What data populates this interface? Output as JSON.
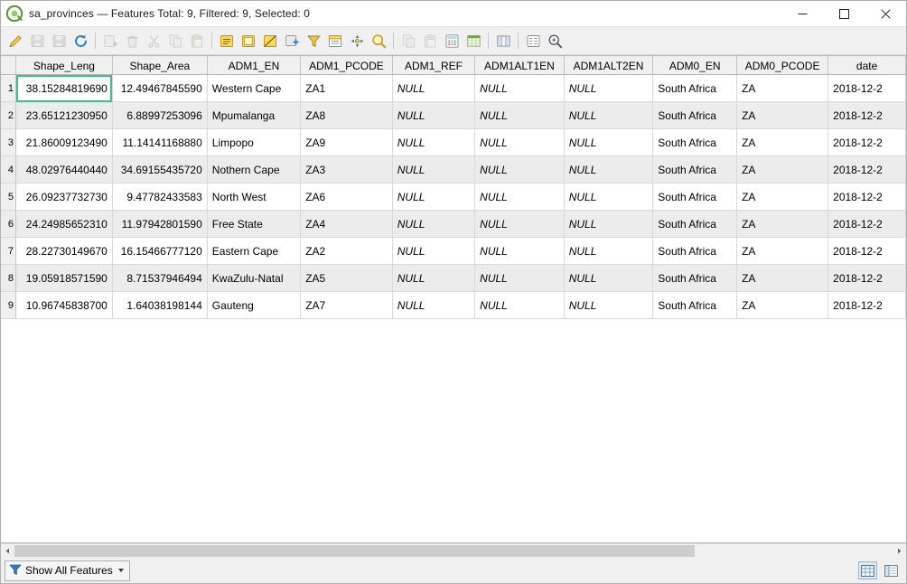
{
  "window": {
    "app_icon": "qgis-logo-icon",
    "title": "sa_provinces — Features Total: 9, Filtered: 9, Selected: 0",
    "controls": {
      "minimize": "minimize-icon",
      "maximize": "maximize-icon",
      "close": "close-icon"
    }
  },
  "toolbar": {
    "items": [
      {
        "name": "toggle-editing-button",
        "icon": "pencil-icon",
        "enabled": true
      },
      {
        "name": "save-edits-button",
        "icon": "save-edits-icon",
        "enabled": false
      },
      {
        "name": "save-layer-edits-button",
        "icon": "floppy-disk-icon",
        "enabled": false
      },
      {
        "name": "reload-table-button",
        "icon": "refresh-icon",
        "enabled": true
      },
      {
        "name": "sep-1",
        "icon": "separator",
        "enabled": false
      },
      {
        "name": "add-feature-button",
        "icon": "add-feature-icon",
        "enabled": false
      },
      {
        "name": "delete-selected-button",
        "icon": "trash-icon",
        "enabled": false
      },
      {
        "name": "cut-features-button",
        "icon": "scissors-icon",
        "enabled": false
      },
      {
        "name": "copy-features-button",
        "icon": "copy-icon",
        "enabled": false
      },
      {
        "name": "paste-features-button",
        "icon": "clipboard-paste-icon",
        "enabled": false
      },
      {
        "name": "sep-2",
        "icon": "separator",
        "enabled": false
      },
      {
        "name": "select-by-expression-button",
        "icon": "select-expression-icon",
        "enabled": true
      },
      {
        "name": "select-all-button",
        "icon": "select-all-icon",
        "enabled": true
      },
      {
        "name": "invert-selection-button",
        "icon": "invert-selection-icon",
        "enabled": true
      },
      {
        "name": "deselect-all-button",
        "icon": "deselect-icon",
        "enabled": true
      },
      {
        "name": "filter-selection-button",
        "icon": "funnel-icon",
        "enabled": true
      },
      {
        "name": "move-selection-top-button",
        "icon": "move-top-icon",
        "enabled": true
      },
      {
        "name": "pan-to-selection-button",
        "icon": "pan-map-icon",
        "enabled": true
      },
      {
        "name": "zoom-to-selection-button",
        "icon": "zoom-map-icon",
        "enabled": true
      },
      {
        "name": "sep-3",
        "icon": "separator",
        "enabled": false
      },
      {
        "name": "copy-selected-rows-button",
        "icon": "copy-rows-icon",
        "enabled": false
      },
      {
        "name": "paste-features-2-button",
        "icon": "paste-rows-icon",
        "enabled": false
      },
      {
        "name": "open-field-calculator-button",
        "icon": "abacus-icon",
        "enabled": true
      },
      {
        "name": "conditional-formatting-button",
        "icon": "table-format-icon",
        "enabled": true
      },
      {
        "name": "sep-4",
        "icon": "separator",
        "enabled": false
      },
      {
        "name": "organize-columns-button",
        "icon": "organize-columns-icon",
        "enabled": true
      },
      {
        "name": "sep-5",
        "icon": "separator",
        "enabled": false
      },
      {
        "name": "add-form-view-button",
        "icon": "form-view-icon",
        "enabled": true
      },
      {
        "name": "actions-button",
        "icon": "actions-zoom-icon",
        "enabled": true
      }
    ]
  },
  "table": {
    "columns": [
      {
        "key": "Shape_Leng",
        "label": "Shape_Leng",
        "align": "num",
        "width": 102
      },
      {
        "key": "Shape_Area",
        "label": "Shape_Area",
        "align": "num",
        "width": 98
      },
      {
        "key": "ADM1_EN",
        "label": "ADM1_EN",
        "align": "txt",
        "width": 107
      },
      {
        "key": "ADM1_PCODE",
        "label": "ADM1_PCODE",
        "align": "txt",
        "width": 101
      },
      {
        "key": "ADM1_REF",
        "label": "ADM1_REF",
        "align": "null",
        "width": 100
      },
      {
        "key": "ADM1ALT1EN",
        "label": "ADM1ALT1EN",
        "align": "null",
        "width": 100
      },
      {
        "key": "ADM1ALT2EN",
        "label": "ADM1ALT2EN",
        "align": "null",
        "width": 100
      },
      {
        "key": "ADM0_EN",
        "label": "ADM0_EN",
        "align": "txt",
        "width": 100
      },
      {
        "key": "ADM0_PCODE",
        "label": "ADM0_PCODE",
        "align": "txt",
        "width": 100
      },
      {
        "key": "date",
        "label": "date",
        "align": "txt",
        "width": 96
      }
    ],
    "null_text": "NULL",
    "selected_cell": {
      "row": 0,
      "column": 0
    },
    "rows": [
      {
        "n": "1",
        "Shape_Leng": "38.15284819690",
        "Shape_Area": "12.49467845590",
        "ADM1_EN": "Western Cape",
        "ADM1_PCODE": "ZA1",
        "ADM1_REF": "NULL",
        "ADM1ALT1EN": "NULL",
        "ADM1ALT2EN": "NULL",
        "ADM0_EN": "South Africa",
        "ADM0_PCODE": "ZA",
        "date": "2018-12-2"
      },
      {
        "n": "2",
        "Shape_Leng": "23.65121230950",
        "Shape_Area": "6.88997253096",
        "ADM1_EN": "Mpumalanga",
        "ADM1_PCODE": "ZA8",
        "ADM1_REF": "NULL",
        "ADM1ALT1EN": "NULL",
        "ADM1ALT2EN": "NULL",
        "ADM0_EN": "South Africa",
        "ADM0_PCODE": "ZA",
        "date": "2018-12-2"
      },
      {
        "n": "3",
        "Shape_Leng": "21.86009123490",
        "Shape_Area": "11.14141168880",
        "ADM1_EN": "Limpopo",
        "ADM1_PCODE": "ZA9",
        "ADM1_REF": "NULL",
        "ADM1ALT1EN": "NULL",
        "ADM1ALT2EN": "NULL",
        "ADM0_EN": "South Africa",
        "ADM0_PCODE": "ZA",
        "date": "2018-12-2"
      },
      {
        "n": "4",
        "Shape_Leng": "48.02976440440",
        "Shape_Area": "34.69155435720",
        "ADM1_EN": "Nothern Cape",
        "ADM1_PCODE": "ZA3",
        "ADM1_REF": "NULL",
        "ADM1ALT1EN": "NULL",
        "ADM1ALT2EN": "NULL",
        "ADM0_EN": "South Africa",
        "ADM0_PCODE": "ZA",
        "date": "2018-12-2"
      },
      {
        "n": "5",
        "Shape_Leng": "26.09237732730",
        "Shape_Area": "9.47782433583",
        "ADM1_EN": "North West",
        "ADM1_PCODE": "ZA6",
        "ADM1_REF": "NULL",
        "ADM1ALT1EN": "NULL",
        "ADM1ALT2EN": "NULL",
        "ADM0_EN": "South Africa",
        "ADM0_PCODE": "ZA",
        "date": "2018-12-2"
      },
      {
        "n": "6",
        "Shape_Leng": "24.24985652310",
        "Shape_Area": "11.97942801590",
        "ADM1_EN": "Free State",
        "ADM1_PCODE": "ZA4",
        "ADM1_REF": "NULL",
        "ADM1ALT1EN": "NULL",
        "ADM1ALT2EN": "NULL",
        "ADM0_EN": "South Africa",
        "ADM0_PCODE": "ZA",
        "date": "2018-12-2"
      },
      {
        "n": "7",
        "Shape_Leng": "28.22730149670",
        "Shape_Area": "16.15466777120",
        "ADM1_EN": "Eastern Cape",
        "ADM1_PCODE": "ZA2",
        "ADM1_REF": "NULL",
        "ADM1ALT1EN": "NULL",
        "ADM1ALT2EN": "NULL",
        "ADM0_EN": "South Africa",
        "ADM0_PCODE": "ZA",
        "date": "2018-12-2"
      },
      {
        "n": "8",
        "Shape_Leng": "19.05918571590",
        "Shape_Area": "8.71537946494",
        "ADM1_EN": "KwaZulu-Natal",
        "ADM1_PCODE": "ZA5",
        "ADM1_REF": "NULL",
        "ADM1ALT1EN": "NULL",
        "ADM1ALT2EN": "NULL",
        "ADM0_EN": "South Africa",
        "ADM0_PCODE": "ZA",
        "date": "2018-12-2"
      },
      {
        "n": "9",
        "Shape_Leng": "10.96745838700",
        "Shape_Area": "1.64038198144",
        "ADM1_EN": "Gauteng",
        "ADM1_PCODE": "ZA7",
        "ADM1_REF": "NULL",
        "ADM1ALT1EN": "NULL",
        "ADM1ALT2EN": "NULL",
        "ADM0_EN": "South Africa",
        "ADM0_PCODE": "ZA",
        "date": "2018-12-2"
      }
    ]
  },
  "statusbar": {
    "filter_label": "Show All Features",
    "filter_icon": "funnel-icon",
    "table_view_icon": "table-view-icon",
    "form_view_icon": "form-view-icon"
  },
  "colors": {
    "selection_outline": "#3fbf8f",
    "qgis_green": "#589632",
    "null_text": "#9a9a9a",
    "alt_row": "#ececec",
    "header_bg": "#f0f0f0",
    "close_hover": "#e81123"
  }
}
